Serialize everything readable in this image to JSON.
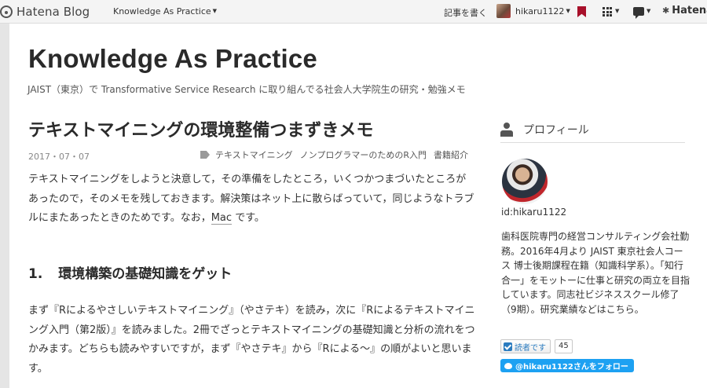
{
  "topbar": {
    "logo_text": "Hatena Blog",
    "blog_select": "Knowledge As Practice",
    "write_link": "記事を書く",
    "user_name": "hikaru1122",
    "hatena_text": "Hatena",
    "icons": [
      "hatena-logo-icon",
      "bookmark-icon",
      "grid-icon",
      "chat-icon"
    ]
  },
  "blog": {
    "title": "Knowledge As Practice",
    "description": "JAIST（東京）で Transformative Service Research に取り組んでる社会人大学院生の研究・勉強メモ"
  },
  "entry": {
    "title": "テキストマイニングの環境整備つまずきメモ",
    "date": "2017・07・07",
    "categories": [
      "テキストマイニング",
      "ノンプログラマーのためのR入門",
      "書籍紹介"
    ],
    "intro": "テキストマイニングをしようと決意して，その準備をしたところ，いくつかつまづいたところがあったので，そのメモを残しておきます。解決策はネット上に散らばっていて，同じようなトラブルにまたあったときのためです。なお，",
    "intro_link": "Mac",
    "intro_tail": "です。",
    "section_number": "1.",
    "section_title": "環境構築の基礎知識をゲット",
    "section_body": "まず『Rによるやさしいテキストマイニング』（やさテキ）を読み，次に『Rによるテキストマイニング入門（第2版）』を読みました。2冊でざっとテキストマイニングの基礎知識と分析の流れをつかみます。どちらも読みやすいですが，まず『やさテキ』から『Rによる～』の順がよいと思います。"
  },
  "sidebar": {
    "profile_label": "プロフィール",
    "profile_id": "id:hikaru1122",
    "profile_bio": "歯科医院専門の経営コンサルティング会社勤務。2016年4月より JAIST 東京社会人コース 博士後期課程在籍（知識科学系）。「知行合一」をモットーに仕事と研究の両立を目指しています。同志社ビジネススクール修了（9期）。研究業績などはこちら。",
    "reader_button": "読者です",
    "reader_count": "45",
    "twitter_button": "@hikaru1122さんをフォロー"
  },
  "colors": {
    "accent": "#2a7bbf",
    "twitter": "#1da1f2",
    "bookmark": "#a8102a"
  }
}
